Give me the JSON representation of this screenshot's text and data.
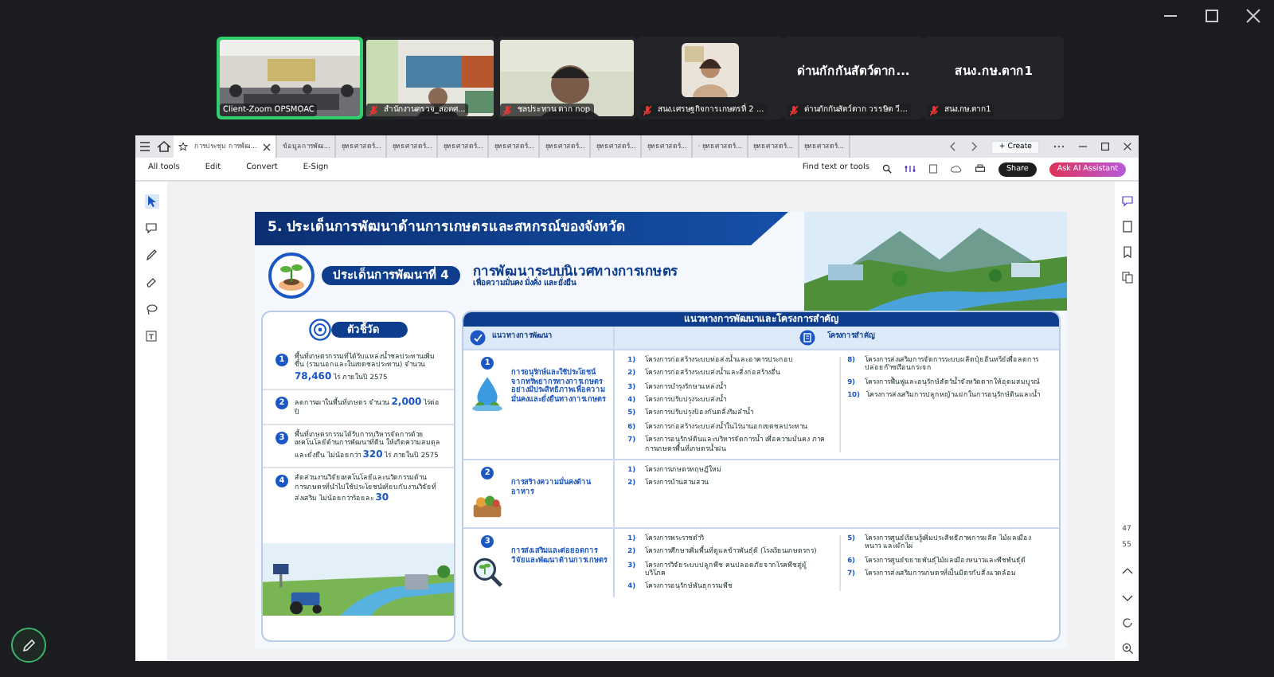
{
  "zoom": {
    "participants": [
      {
        "name": "Client-Zoom OPSMOAC",
        "kind": "video",
        "muted": false,
        "speaking": true
      },
      {
        "name": "สำนักงานตรวจ_สอดศ...",
        "kind": "video",
        "muted": true,
        "speaking": false
      },
      {
        "name": "ชลประทาน ตาก nop",
        "kind": "video",
        "muted": true,
        "speaking": false
      },
      {
        "name": "สนง.เศรษฐกิจการเกษตรที่ 2 ...",
        "muted": true,
        "speaking": false
      },
      {
        "name": "ด่านกักกันสัตว์ตาก วรรษิต วี...",
        "kind": "name",
        "display_text": "ด่านกักกันสัตว์ตาก...",
        "muted": true,
        "speaking": false
      },
      {
        "name": "สนง.กษ.ตาก1",
        "kind": "name",
        "display_text": "สนง.กษ.ตาก1",
        "muted": true,
        "speaking": false
      }
    ]
  },
  "viewer": {
    "tabs": [
      {
        "label": "การประชุม การพัฒ...",
        "selected": true
      },
      {
        "label": "ข้อมูลการพัฒ...",
        "selected": false
      },
      {
        "label": "ยุทธศาสตร์...",
        "selected": false
      },
      {
        "label": "ยุทธศาสตร์...",
        "selected": false
      },
      {
        "label": "ยุทธศาสตร์...",
        "selected": false
      },
      {
        "label": "ยุทธศาสตร์...",
        "selected": false
      },
      {
        "label": "ยุทธศาสตร์...",
        "selected": false
      },
      {
        "label": "ยุทธศาสตร์...",
        "selected": false
      },
      {
        "label": "ยุทธศาสตร์...",
        "selected": false
      },
      {
        "label": "· ยุทธศาสตร์...",
        "selected": false
      },
      {
        "label": "ยุทธศาสตร์...",
        "selected": false
      },
      {
        "label": "ยุทธศาสตร์...",
        "selected": false
      }
    ],
    "create_button": "+ Create",
    "menu": [
      "All tools",
      "Edit",
      "Convert",
      "E-Sign"
    ],
    "find_label": "Find text or tools",
    "share_button": "Share",
    "ai_button": "Ask AI Assistant",
    "page_number": "47",
    "page_total": "55"
  },
  "slide": {
    "title": "5. ประเด็นการพัฒนาด้านการเกษตรและสหกรณ์ของจังหวัด",
    "issue_label": "ประเด็นการพัฒนาที่ 4",
    "issue_title": "การพัฒนาระบบนิเวศทางการเกษตร",
    "issue_subtitle": "เพื่อความมั่นคง มั่งคั่ง และยั่งยืน",
    "indicators_heading": "ตัวชี้วัด",
    "indicators": [
      {
        "number": "1",
        "text": "พื้นที่เกษตรกรรมที่ได้รับแหล่งน้ำชลประทานเพิ่มขึ้น (รวมนอกและในเขตชลประทาน) จำนวน **78,460** ไร่ ภายในปี 2575"
      },
      {
        "number": "2",
        "text": "ลดการเผาในพื้นที่เกษตร จำนวน **2,000** ไร่ต่อปี"
      },
      {
        "number": "3",
        "text": "พื้นที่เกษตรกรรมได้รับการบริหารจัดการด้วยเทคโนโลยีด้านการพัฒนาที่ดิน ให้เกิดความสมดุลและยั่งยืน ไม่น้อยกว่า **320** ไร่ ภายในปี 2575"
      },
      {
        "number": "4",
        "text": "สัดส่วนงานวิจัยเทคโนโลยีและนวัตกรรมด้านการเกษตรที่นำไปใช้ประโยชน์เทียบกับงานวิจัยที่ส่งเสริม ไม่น้อยกว่าร้อยละ **30**"
      }
    ],
    "guidelines": {
      "heading": "แนวทางการพัฒนาและโครงการสำคัญ",
      "column_headers": [
        "แนวทางการพัฒนา",
        "โครงการสำคัญ"
      ],
      "rows": [
        {
          "number": "1",
          "kind": "water",
          "title": "การอนุรักษ์และใช้ประโยชน์จากทรัพยากรทางการเกษตรอย่างมีประสิทธิภาพเพื่อความมั่นคงและยั่งยืนทางการเกษตร",
          "projects": [
            [
              {
                "number": "1)",
                "text": "โครงการก่อสร้างระบบท่อส่งน้ำและอาคารประกอบ"
              },
              {
                "number": "2)",
                "text": "โครงการก่อสร้างระบบส่งน้ำและสิ่งก่อสร้างอื่น"
              },
              {
                "number": "3)",
                "text": "โครงการบำรุงรักษาแหล่งน้ำ"
              },
              {
                "number": "4)",
                "text": "โครงการปรับปรุงระบบส่งน้ำ"
              },
              {
                "number": "5)",
                "text": "โครงการปรับปรุงป้องกันตลิ่งริมลำน้ำ"
              },
              {
                "number": "6)",
                "text": "โครงการก่อสร้างระบบส่งน้ำในไร่นานอกเขตชลประทาน"
              },
              {
                "number": "7)",
                "text": "โครงการอนุรักษ์ดินและบริหารจัดการน้ำ เพื่อความมั่นคง ภาคการเกษตรพื้นที่เกษตรน้ำฝน"
              }
            ],
            [
              {
                "number": "8)",
                "text": "โครงการส่งเสริมการจัดการระบบผลิตปุ๋ยอินทรีย์เพื่อลดการปล่อยก๊าซเรือนกระจก"
              },
              {
                "number": "9)",
                "text": "โครงการฟื้นฟูและอนุรักษ์สัตว์น้ำจังหวัดตากให้อุดมสมบูรณ์"
              },
              {
                "number": "10)",
                "text": "โครงการส่งเสริมการปลูกหญ้าแฝกในการอนุรักษ์ดินและน้ำ"
              }
            ]
          ]
        },
        {
          "number": "2",
          "kind": "food",
          "title": "การสร้างความมั่นคงด้านอาหาร",
          "projects": [
            [
              {
                "number": "1)",
                "text": "โครงการเกษตรทฤษฎีใหม่"
              },
              {
                "number": "2)",
                "text": "โครงการบ้านสามสวน"
              }
            ]
          ]
        },
        {
          "number": "3",
          "kind": "research",
          "title": "การส่งเสริมและต่อยอดการวิจัยและพัฒนาด้านการเกษตร",
          "projects": [
            [
              {
                "number": "1)",
                "text": "โครงการพระราชดำริ"
              },
              {
                "number": "2)",
                "text": "โครงการศึกษาเพิ่มพื้นที่ดูแลข้าวพันธุ์ดี (โรงเรียนเกษตรกร)"
              },
              {
                "number": "3)",
                "text": "โครงการวิจัยระบบปลูกพืช คนปลอดภัยจากโรคพืชสู่ผู้บริโภค"
              },
              {
                "number": "4)",
                "text": "โครงการอนุรักษ์พันธุกรรมพืช"
              }
            ],
            [
              {
                "number": "5)",
                "text": "โครงการศูนย์เรียนรู้เพิ่มประสิทธิภาพการผลิต ไม้ผลเมืองหนาว และผักไผ่"
              },
              {
                "number": "6)",
                "text": "โครงการศูนย์ขยายพันธุ์ไม้ผลเมืองหนาวและพืชพันธุ์ดี"
              },
              {
                "number": "7)",
                "text": "โครงการส่งเสริมการเกษตรที่เป็นมิตรกับสิ่งแวดล้อม"
              }
            ]
          ]
        }
      ]
    }
  }
}
